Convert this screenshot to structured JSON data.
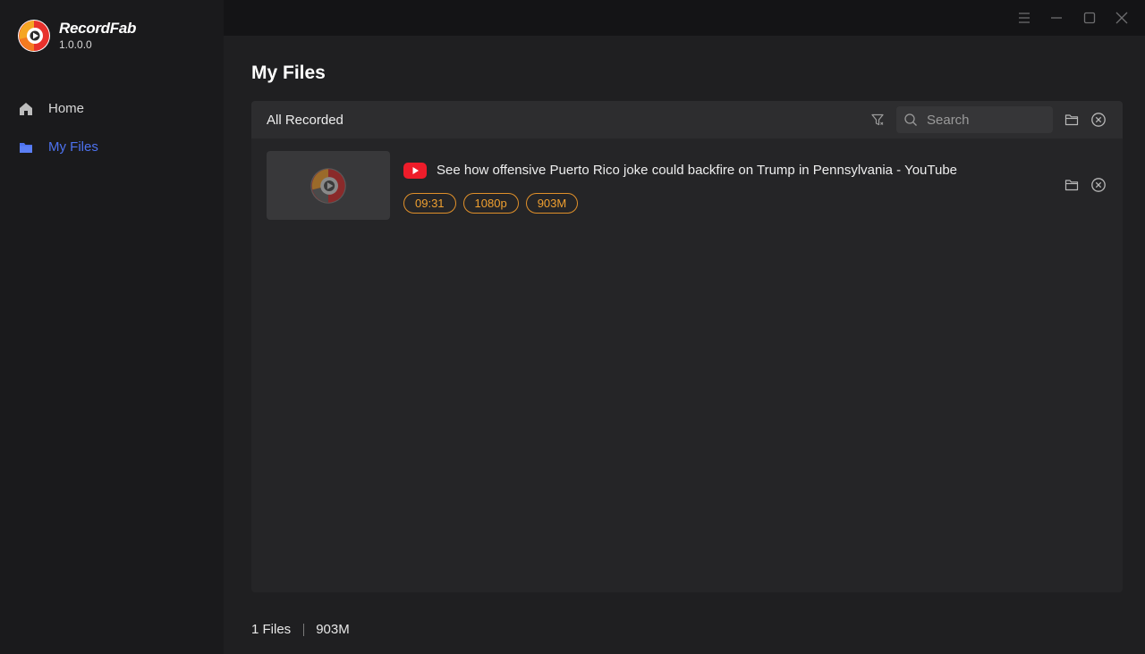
{
  "app": {
    "name": "RecordFab",
    "version": "1.0.0.0"
  },
  "nav": {
    "items": [
      {
        "label": "Home",
        "icon": "home-icon",
        "active": false
      },
      {
        "label": "My Files",
        "icon": "folder-icon",
        "active": true
      }
    ]
  },
  "window_controls": [
    "menu-icon",
    "minimize-icon",
    "maximize-icon",
    "close-icon"
  ],
  "main": {
    "title": "My Files",
    "panel": {
      "title": "All Recorded",
      "search": {
        "placeholder": "Search",
        "value": ""
      }
    },
    "files": [
      {
        "source_icon": "youtube-icon",
        "title": "See how offensive Puerto Rico joke could backfire on Trump in Pennsylvania - YouTube",
        "duration": "09:31",
        "resolution": "1080p",
        "size": "903M"
      }
    ],
    "footer": {
      "count": "1 Files",
      "total_size": "903M"
    }
  },
  "colors": {
    "accent": "#4d72f0",
    "tag": "#f0a030",
    "youtube": "#ee1c2a"
  }
}
